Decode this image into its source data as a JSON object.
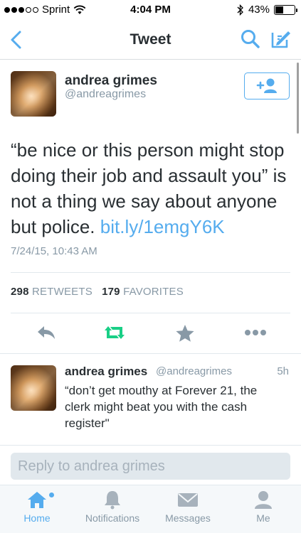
{
  "status_bar": {
    "carrier": "Sprint",
    "time": "4:04 PM",
    "battery_text": "43%",
    "battery_level": 0.43
  },
  "nav": {
    "title": "Tweet",
    "icons": [
      "back-chevron-icon",
      "search-icon",
      "compose-icon"
    ]
  },
  "tweet": {
    "author_name": "andrea grimes",
    "author_handle": "@andreagrimes",
    "text": "“be nice or this person might stop doing their job and assault you” is not a thing we say about anyone but police.",
    "link": "bit.ly/1emgY6K",
    "timestamp": "7/24/15, 10:43 AM",
    "retweets_count": "298",
    "retweets_label": "RETWEETS",
    "favorites_count": "179",
    "favorites_label": "FAVORITES"
  },
  "actions": [
    "reply-icon",
    "retweet-icon",
    "favorite-star-icon",
    "more-icon"
  ],
  "reply": {
    "author_name": "andrea grimes",
    "author_handle": "@andreagrimes",
    "time_ago": "5h",
    "text": "“don’t get mouthy at Forever 21, the clerk might beat you with the cash register\""
  },
  "reply_box": {
    "placeholder": "Reply to andrea grimes"
  },
  "tabs": [
    {
      "label": "Home",
      "icon": "home-icon",
      "active": true
    },
    {
      "label": "Notifications",
      "icon": "bell-icon",
      "active": false
    },
    {
      "label": "Messages",
      "icon": "envelope-icon",
      "active": false
    },
    {
      "label": "Me",
      "icon": "person-icon",
      "active": false
    }
  ],
  "colors": {
    "accent": "#55acee",
    "retweet_green": "#19cf86",
    "muted": "#8899a6",
    "text": "#292f33"
  }
}
